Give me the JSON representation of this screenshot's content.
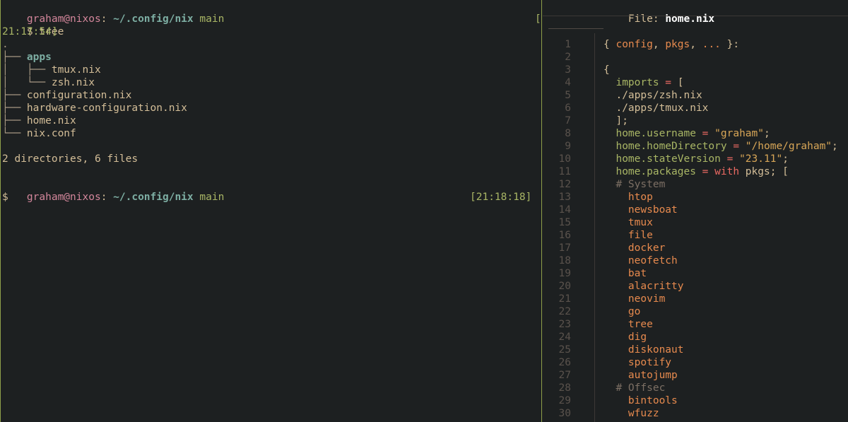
{
  "terminal": {
    "prompt1": {
      "user": "graham@nixos",
      "sep": ": ",
      "path": "~/.config/nix",
      "branch": " main"
    },
    "command": "$ tree",
    "timestamp1_bracket": "[",
    "timestamp1_rest": "21:17:54]",
    "tree": [
      {
        "guide": ".",
        "name": "",
        "dir": false
      },
      {
        "guide": "├── ",
        "name": "apps",
        "dir": true
      },
      {
        "guide": "│   ├── ",
        "name": "tmux.nix",
        "dir": false
      },
      {
        "guide": "│   └── ",
        "name": "zsh.nix",
        "dir": false
      },
      {
        "guide": "├── ",
        "name": "configuration.nix",
        "dir": false
      },
      {
        "guide": "├── ",
        "name": "hardware-configuration.nix",
        "dir": false
      },
      {
        "guide": "├── ",
        "name": "home.nix",
        "dir": false
      },
      {
        "guide": "└── ",
        "name": "nix.conf",
        "dir": false
      }
    ],
    "summary": "2 directories, 6 files",
    "prompt2": {
      "user": "graham@nixos",
      "sep": ": ",
      "path": "~/.config/nix",
      "branch": " main"
    },
    "prompt2_symbol": "$",
    "timestamp2": "[21:18:18]"
  },
  "viewer": {
    "file_label": "File: ",
    "file_name": "home.nix",
    "lines": [
      {
        "n": "1",
        "parts": [
          [
            "t-plain",
            "{ "
          ],
          [
            "t-orange",
            "config"
          ],
          [
            "t-plain",
            ", "
          ],
          [
            "t-orange",
            "pkgs"
          ],
          [
            "t-plain",
            ", "
          ],
          [
            "t-orange",
            "..."
          ],
          [
            "t-plain",
            " }:"
          ]
        ]
      },
      {
        "n": "2",
        "parts": []
      },
      {
        "n": "3",
        "parts": [
          [
            "t-plain",
            "{"
          ]
        ]
      },
      {
        "n": "4",
        "parts": [
          [
            "t-ident",
            "  imports"
          ],
          [
            "t-red",
            " ="
          ],
          [
            "t-plain",
            " ["
          ]
        ]
      },
      {
        "n": "5",
        "parts": [
          [
            "t-path",
            "  ./apps/zsh.nix"
          ]
        ]
      },
      {
        "n": "6",
        "parts": [
          [
            "t-path",
            "  ./apps/tmux.nix"
          ]
        ]
      },
      {
        "n": "7",
        "parts": [
          [
            "t-plain",
            "  ];"
          ]
        ]
      },
      {
        "n": "8",
        "parts": [
          [
            "t-ident",
            "  home.username"
          ],
          [
            "t-red",
            " ="
          ],
          [
            "t-string",
            " \"graham\""
          ],
          [
            "t-plain",
            ";"
          ]
        ]
      },
      {
        "n": "9",
        "parts": [
          [
            "t-ident",
            "  home.homeDirectory"
          ],
          [
            "t-red",
            " ="
          ],
          [
            "t-string",
            " \"/home/graham\""
          ],
          [
            "t-plain",
            ";"
          ]
        ]
      },
      {
        "n": "10",
        "parts": [
          [
            "t-ident",
            "  home.stateVersion"
          ],
          [
            "t-red",
            " ="
          ],
          [
            "t-string",
            " \"23.11\""
          ],
          [
            "t-plain",
            ";"
          ]
        ]
      },
      {
        "n": "11",
        "parts": [
          [
            "t-ident",
            "  home.packages"
          ],
          [
            "t-red",
            " ="
          ],
          [
            "t-red",
            " with"
          ],
          [
            "t-plain",
            " pkgs; ["
          ]
        ]
      },
      {
        "n": "12",
        "parts": [
          [
            "t-comment",
            "  # System"
          ]
        ]
      },
      {
        "n": "13",
        "parts": [
          [
            "t-orange",
            "    htop"
          ]
        ]
      },
      {
        "n": "14",
        "parts": [
          [
            "t-orange",
            "    newsboat"
          ]
        ]
      },
      {
        "n": "15",
        "parts": [
          [
            "t-orange",
            "    tmux"
          ]
        ]
      },
      {
        "n": "16",
        "parts": [
          [
            "t-orange",
            "    file"
          ]
        ]
      },
      {
        "n": "17",
        "parts": [
          [
            "t-orange",
            "    docker"
          ]
        ]
      },
      {
        "n": "18",
        "parts": [
          [
            "t-orange",
            "    neofetch"
          ]
        ]
      },
      {
        "n": "19",
        "parts": [
          [
            "t-orange",
            "    bat"
          ]
        ]
      },
      {
        "n": "20",
        "parts": [
          [
            "t-orange",
            "    alacritty"
          ]
        ]
      },
      {
        "n": "21",
        "parts": [
          [
            "t-orange",
            "    neovim"
          ]
        ]
      },
      {
        "n": "22",
        "parts": [
          [
            "t-orange",
            "    go"
          ]
        ]
      },
      {
        "n": "23",
        "parts": [
          [
            "t-orange",
            "    tree"
          ]
        ]
      },
      {
        "n": "24",
        "parts": [
          [
            "t-orange",
            "    dig"
          ]
        ]
      },
      {
        "n": "25",
        "parts": [
          [
            "t-orange",
            "    diskonaut"
          ]
        ]
      },
      {
        "n": "26",
        "parts": [
          [
            "t-orange",
            "    spotify"
          ]
        ]
      },
      {
        "n": "27",
        "parts": [
          [
            "t-orange",
            "    autojump"
          ]
        ]
      },
      {
        "n": "28",
        "parts": [
          [
            "t-comment",
            "  # Offsec"
          ]
        ]
      },
      {
        "n": "29",
        "parts": [
          [
            "t-orange",
            "    bintools"
          ]
        ]
      },
      {
        "n": "30",
        "parts": [
          [
            "t-orange",
            "    wfuzz"
          ]
        ]
      }
    ]
  }
}
